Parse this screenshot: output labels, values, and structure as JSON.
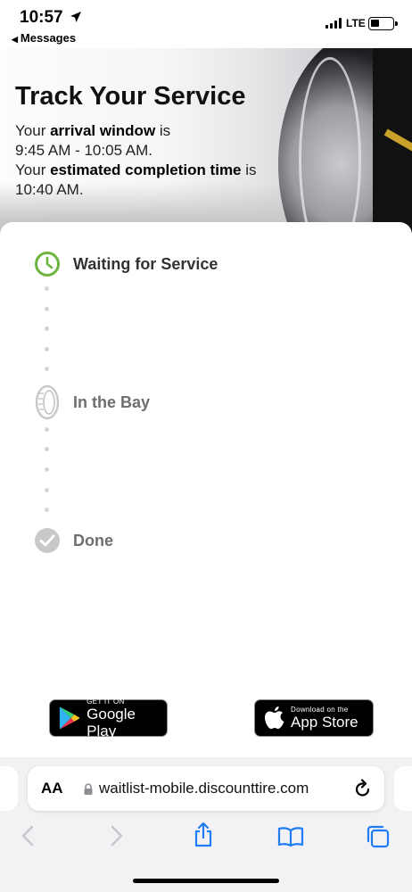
{
  "status_bar": {
    "time": "10:57",
    "back_app": "Messages",
    "network": "LTE"
  },
  "hero": {
    "title": "Track Your Service",
    "line1_prefix": "Your ",
    "line1_bold": "arrival window",
    "line1_suffix": " is",
    "line2": "9:45 AM - 10:05 AM.",
    "line3_prefix": "Your ",
    "line3_bold": "estimated completion time",
    "line3_suffix": " is",
    "line4": "10:40 AM."
  },
  "steps": [
    {
      "label": "Waiting for Service",
      "icon": "clock-icon",
      "state": "active"
    },
    {
      "label": "In the Bay",
      "icon": "tire-icon",
      "state": "pending"
    },
    {
      "label": "Done",
      "icon": "check-circle-icon",
      "state": "pending"
    }
  ],
  "badges": {
    "google_play_small": "GET IT ON",
    "google_play_big": "Google Play",
    "app_store_small": "Download on the",
    "app_store_big": "App Store"
  },
  "browser": {
    "aa": "AA",
    "url": "waitlist-mobile.discounttire.com"
  },
  "colors": {
    "active_green": "#6db33f",
    "inactive_gray": "#c8c8c8",
    "safari_blue": "#1f7cf4"
  }
}
